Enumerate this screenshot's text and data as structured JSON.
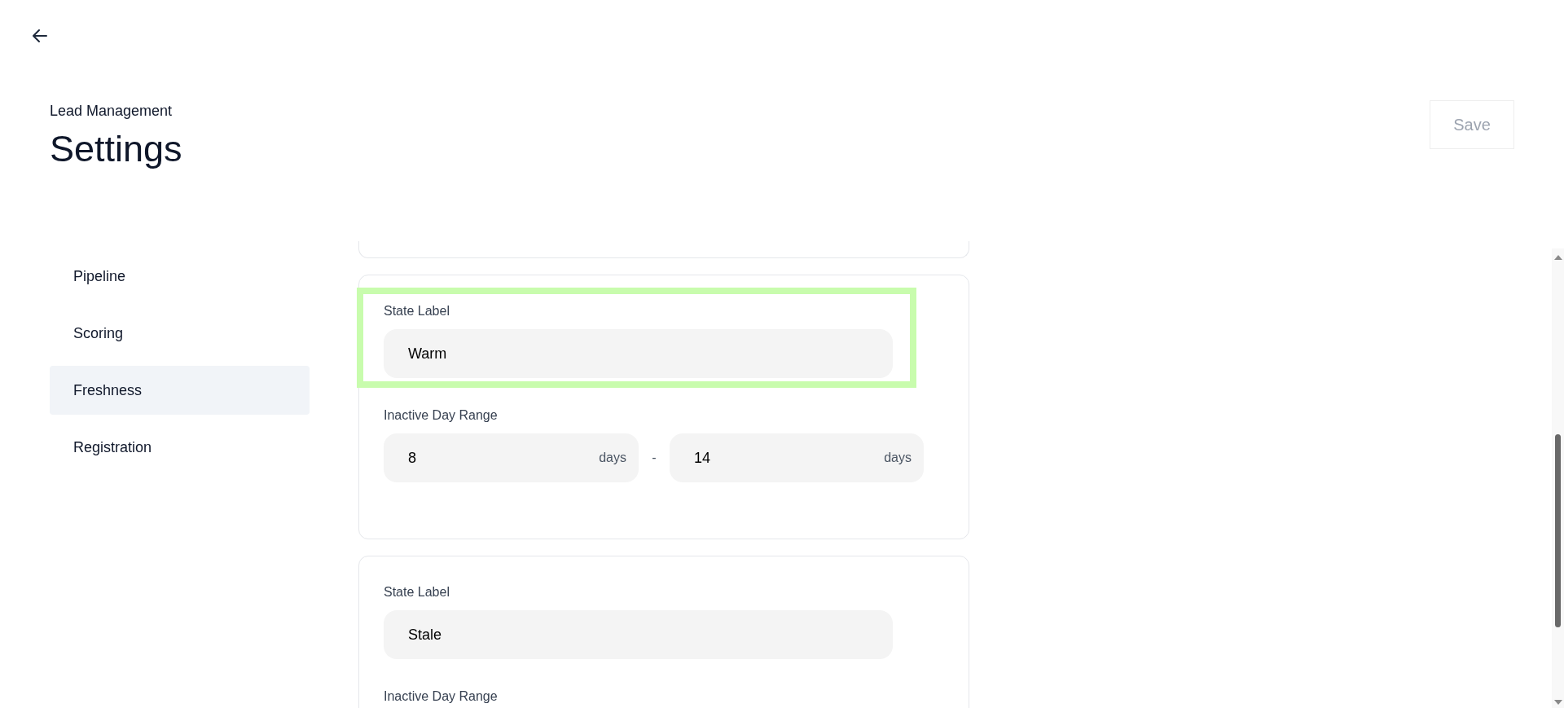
{
  "header": {
    "subtitle": "Lead Management",
    "title": "Settings",
    "save_button": {
      "label": "Save",
      "disabled": true
    }
  },
  "sidebar": {
    "items": [
      {
        "label": "Pipeline",
        "selected": false
      },
      {
        "label": "Scoring",
        "selected": false
      },
      {
        "label": "Freshness",
        "selected": true
      },
      {
        "label": "Registration",
        "selected": false
      }
    ]
  },
  "states": [
    {
      "label_title": "State Label",
      "value": "Warm",
      "highlighted": true,
      "range_title": "Inactive Day Range",
      "from": "8",
      "from_unit": "days",
      "separator": "-",
      "to": "14",
      "to_unit": "days"
    },
    {
      "label_title": "State Label",
      "value": "Stale",
      "highlighted": false,
      "range_title": "Inactive Day Range"
    }
  ]
}
